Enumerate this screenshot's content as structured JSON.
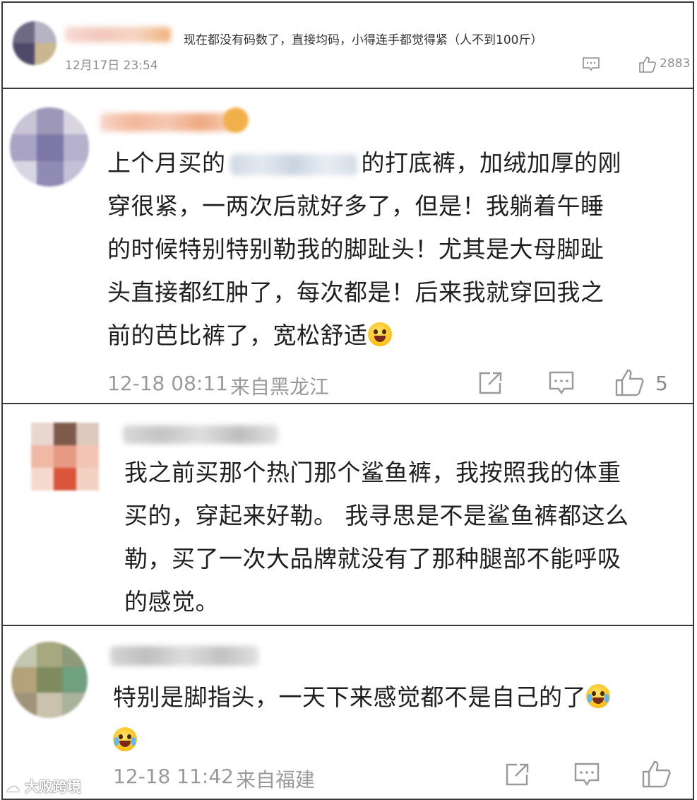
{
  "comments": [
    {
      "text": "现在都没有码数了，直接均码，小得连手都觉得紧（人不到100斤）",
      "time": "12月17日 23:54",
      "likes": "2883"
    },
    {
      "lines": [
        "上个月买的",
        "的打底裤，加绒加厚的刚",
        "穿很紧，一两次后就好多了，但是！我躺着午睡",
        "的时候特别特别勒我的脚趾头！尤其是大母脚趾",
        "头直接都红肿了，每次都是！后来我就穿回我之",
        "前的芭比裤了，宽松舒适"
      ],
      "time": "12-18 08:11",
      "location": "来自黑龙江",
      "likes": "5"
    },
    {
      "lines": [
        "我之前买那个热门那个鲨鱼裤，我按照我的体重",
        "买的，穿起来好勒。 我寻思是不是鲨鱼裤都这么",
        "勒，买了一次大品牌就没有了那种腿部不能呼吸",
        "的感觉。"
      ]
    },
    {
      "lines": [
        "特别是脚指头，一天下来感觉都不是自己的了"
      ],
      "time": "12-18 11:42",
      "location": "来自福建"
    }
  ],
  "icons": {
    "share": "share-icon",
    "comment": "comment-icon",
    "like": "thumbs-up-icon",
    "emoji_laugh": "laughing-tears-emoji",
    "emoji_wink": "playful-face-emoji"
  },
  "watermark": "大败跨境"
}
